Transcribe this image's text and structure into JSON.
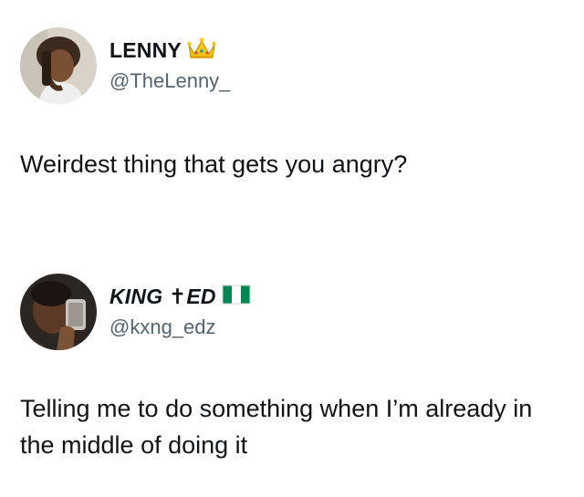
{
  "tweets": [
    {
      "display_name": "LENNY",
      "name_badge": "crown-icon",
      "handle": "@TheLenny_",
      "text": "Weirdest thing that gets you angry?"
    },
    {
      "display_name": "KING ✝ED",
      "name_badge": "nigeria-flag-icon",
      "handle": "@kxng_edz",
      "text": "Telling me to do something when I’m already in the middle of doing it"
    }
  ],
  "colors": {
    "text": "#0f1419",
    "handle": "#536471",
    "crown": "#f5c518",
    "flag_green": "#008751"
  }
}
